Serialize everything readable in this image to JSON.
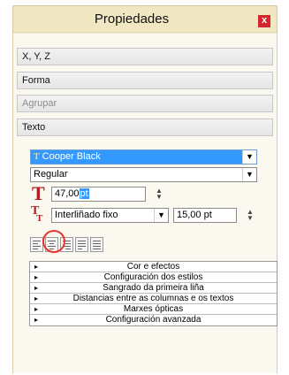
{
  "panel": {
    "title": "Propiedades",
    "close_label": "x"
  },
  "sections": [
    {
      "label": "X, Y, Z"
    },
    {
      "label": "Forma"
    },
    {
      "label": "Agrupar"
    },
    {
      "label": "Texto"
    }
  ],
  "text": {
    "font_family": "Cooper Black",
    "font_style": "Regular",
    "font_size_number": "47,00",
    "font_size_unit": "pt",
    "line_spacing_mode": "Interliñado fixo",
    "line_spacing_value": "15,00 pt"
  },
  "alignment_buttons": [
    {
      "name": "align-left"
    },
    {
      "name": "align-center"
    },
    {
      "name": "align-right"
    },
    {
      "name": "align-justify"
    },
    {
      "name": "align-forced-justify"
    }
  ],
  "accordion": [
    {
      "label": "Cor e efectos"
    },
    {
      "label": "Configuración dos estilos"
    },
    {
      "label": "Sangrado da primeira liña"
    },
    {
      "label": "Distancias entre as columnas e os textos"
    },
    {
      "label": "Marxes ópticas"
    },
    {
      "label": "Configuración avanzada"
    }
  ],
  "colors": {
    "accent": "#3399ff",
    "close": "#d3262e",
    "highlight_circle": "#e8342f",
    "icon_red": "#b51c1c"
  }
}
